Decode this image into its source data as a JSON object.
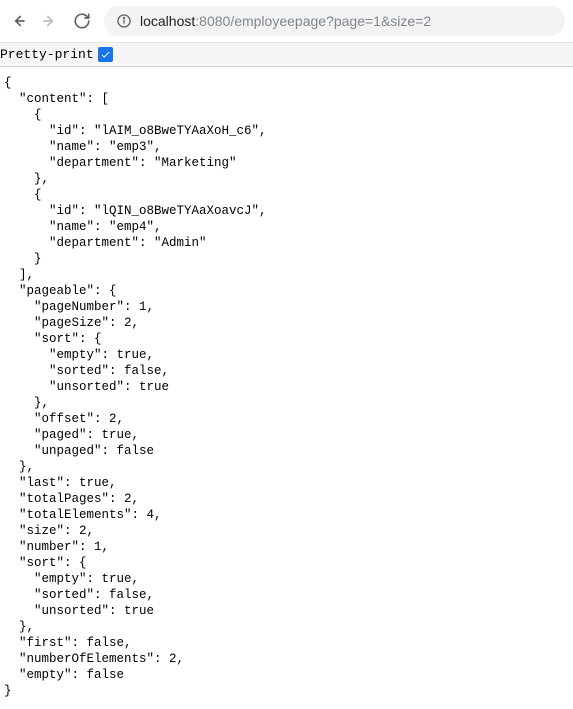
{
  "toolbar": {
    "url_host": "localhost",
    "url_port": ":8080",
    "url_path": "/employeepage?page=1&size=2"
  },
  "prettyBar": {
    "label": "Pretty-print",
    "checked": true
  },
  "jsonContent": "{\n  \"content\": [\n    {\n      \"id\": \"lAIM_o8BweTYAaXoH_c6\",\n      \"name\": \"emp3\",\n      \"department\": \"Marketing\"\n    },\n    {\n      \"id\": \"lQIN_o8BweTYAaXoavcJ\",\n      \"name\": \"emp4\",\n      \"department\": \"Admin\"\n    }\n  ],\n  \"pageable\": {\n    \"pageNumber\": 1,\n    \"pageSize\": 2,\n    \"sort\": {\n      \"empty\": true,\n      \"sorted\": false,\n      \"unsorted\": true\n    },\n    \"offset\": 2,\n    \"paged\": true,\n    \"unpaged\": false\n  },\n  \"last\": true,\n  \"totalPages\": 2,\n  \"totalElements\": 4,\n  \"size\": 2,\n  \"number\": 1,\n  \"sort\": {\n    \"empty\": true,\n    \"sorted\": false,\n    \"unsorted\": true\n  },\n  \"first\": false,\n  \"numberOfElements\": 2,\n  \"empty\": false\n}"
}
